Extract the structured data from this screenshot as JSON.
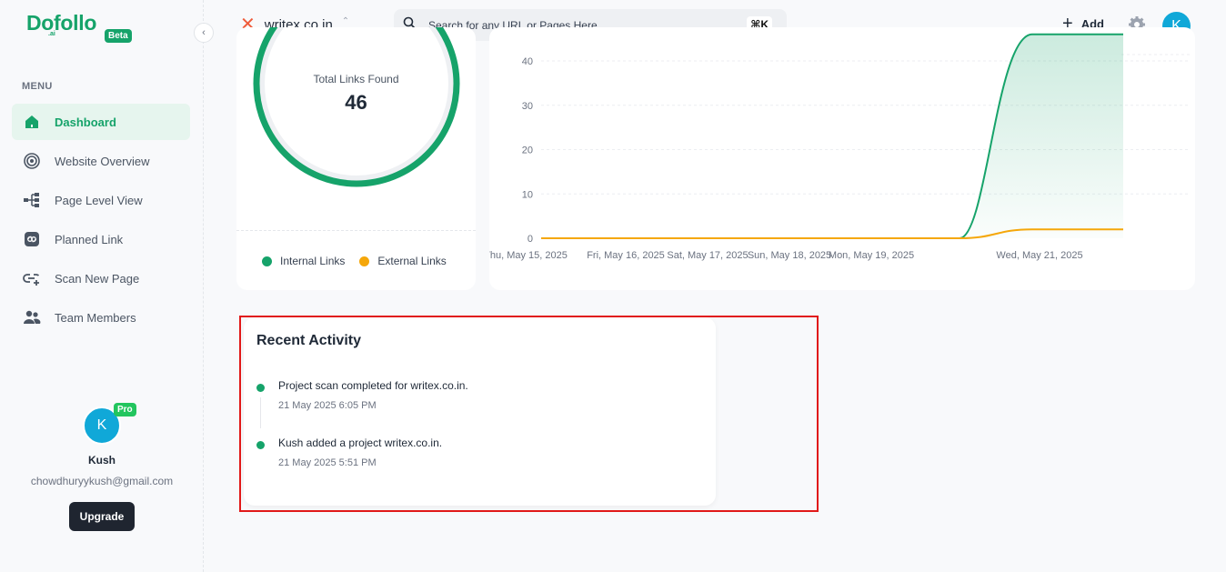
{
  "brand": {
    "name": "Dofollo",
    "suffix": ".ai",
    "badge": "Beta"
  },
  "sidebar": {
    "menu_title": "MENU",
    "items": [
      {
        "label": "Dashboard",
        "icon": "home-icon",
        "active": true
      },
      {
        "label": "Website Overview",
        "icon": "overview-icon"
      },
      {
        "label": "Page Level View",
        "icon": "hierarchy-icon"
      },
      {
        "label": "Planned Link",
        "icon": "link-icon"
      },
      {
        "label": "Scan New Page",
        "icon": "link-add-icon"
      },
      {
        "label": "Team Members",
        "icon": "users-icon"
      }
    ],
    "profile": {
      "initial": "K",
      "badge": "Pro",
      "name": "Kush",
      "email": "chowdhuryykush@gmail.com",
      "upgrade_label": "Upgrade"
    }
  },
  "header": {
    "site": "writex.co.in",
    "search_placeholder": "Search for any URL or Pages Here",
    "shortcut": "⌘K",
    "add_label": "Add",
    "user_initial": "K"
  },
  "donut": {
    "label": "Total Links Found",
    "value": "46",
    "legend": [
      {
        "label": "Internal Links",
        "color": "#16a36a"
      },
      {
        "label": "External Links",
        "color": "#f5a70a"
      }
    ]
  },
  "chart_data": {
    "type": "area",
    "y_ticks": [
      "40",
      "30",
      "20",
      "10",
      "0"
    ],
    "x_labels": [
      "Thu, May 15, 2025",
      "Fri, May 16, 2025",
      "Sat, May 17, 2025",
      "Sun, May 18, 2025",
      "Mon, May 19, 2025",
      "Wed, May 21, 2025"
    ],
    "series": [
      {
        "name": "Internal Links",
        "color": "#16a36a",
        "values": [
          0,
          0,
          0,
          0,
          0,
          0,
          46
        ]
      },
      {
        "name": "External Links",
        "color": "#f5a70a",
        "values": [
          0,
          0,
          0,
          0,
          0,
          0,
          2
        ]
      }
    ]
  },
  "activity": {
    "title": "Recent Activity",
    "items": [
      {
        "text": "Project scan completed for writex.co.in.",
        "time": "21 May 2025 6:05 PM"
      },
      {
        "text": "Kush added a project writex.co.in.",
        "time": "21 May 2025 5:51 PM"
      }
    ]
  }
}
